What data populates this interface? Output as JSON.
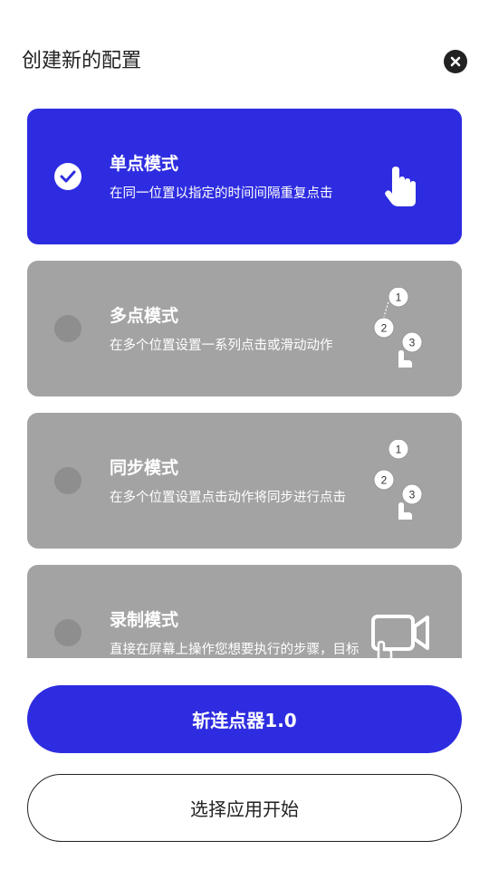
{
  "dialog": {
    "title": "创建新的配置",
    "close_icon": "close-icon"
  },
  "modes": [
    {
      "title": "单点模式",
      "description": "在同一位置以指定的时间间隔重复点击",
      "selected": true,
      "icon": "single-tap-icon"
    },
    {
      "title": "多点模式",
      "description": "在多个位置设置一系列点击或滑动动作",
      "selected": false,
      "icon": "multi-tap-icon",
      "icon_numbers": [
        "1",
        "2",
        "3"
      ]
    },
    {
      "title": "同步模式",
      "description": "在多个位置设置点击动作将同步进行点击",
      "selected": false,
      "icon": "sync-tap-icon",
      "icon_numbers": [
        "1",
        "2",
        "3"
      ]
    },
    {
      "title": "录制模式",
      "description": "直接在屏幕上操作您想要执行的步骤，目标操作将自动添加",
      "selected": false,
      "icon": "record-icon"
    }
  ],
  "buttons": {
    "primary": "斩连点器1.0",
    "secondary": "选择应用开始"
  },
  "colors": {
    "accent": "#2e2ce0",
    "card_unselected": "#a3a3a3",
    "radio_unselected": "#8e8e8e"
  }
}
